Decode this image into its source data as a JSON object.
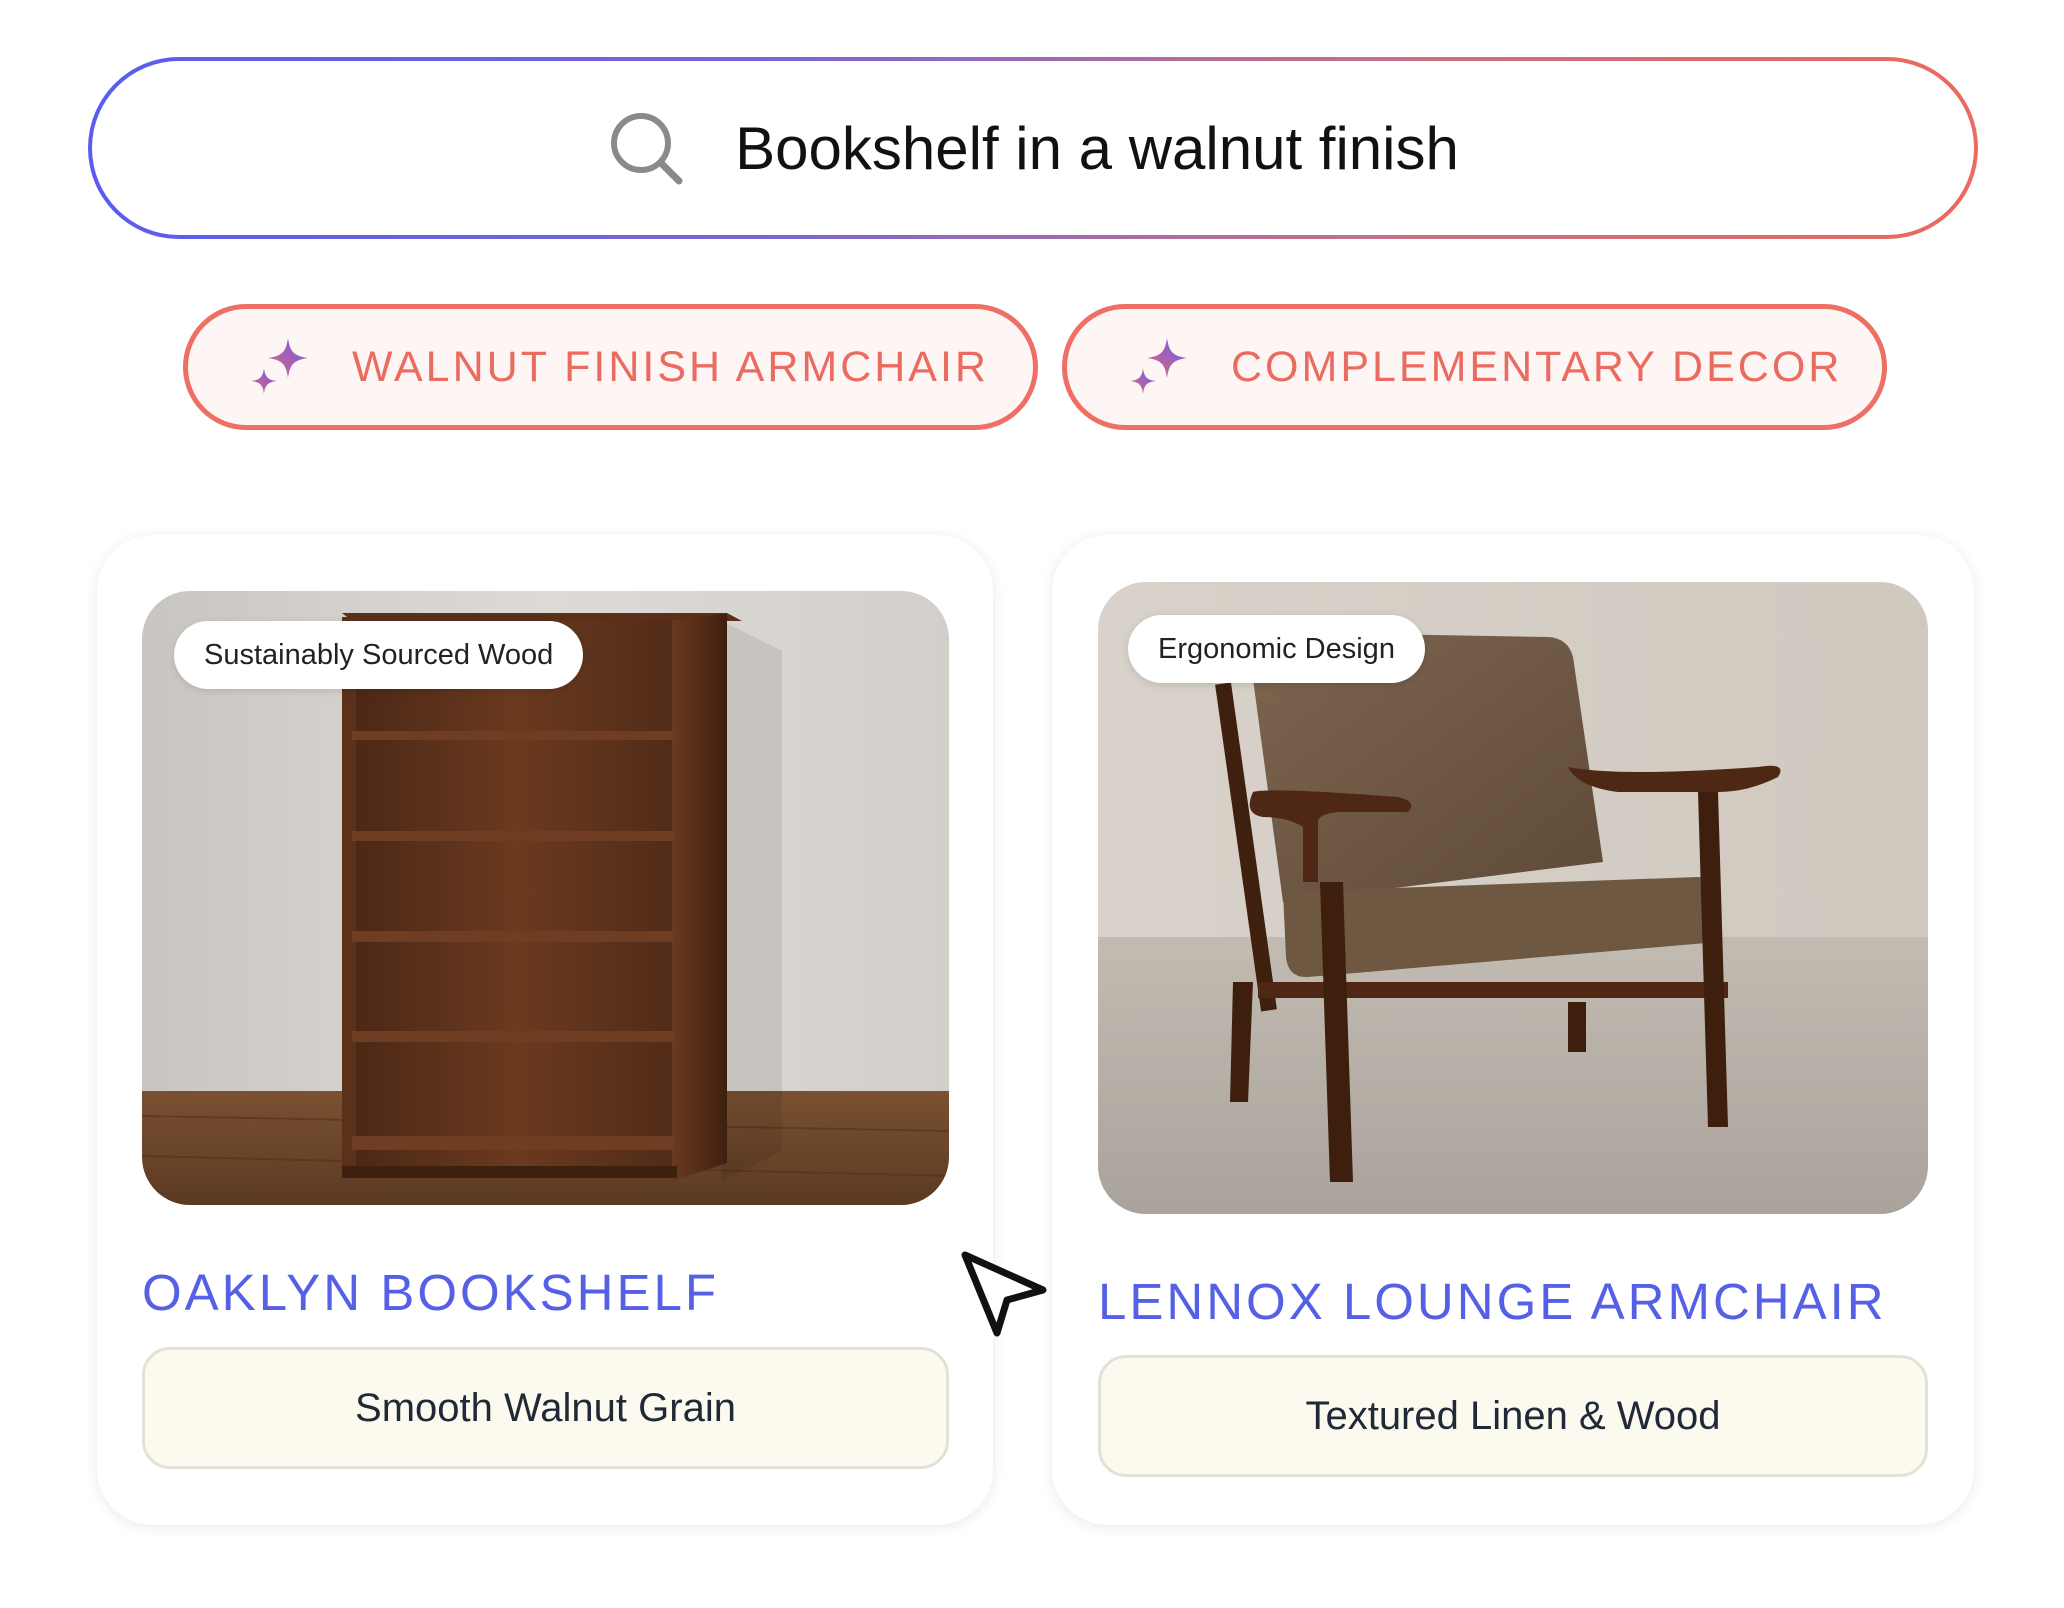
{
  "search": {
    "query": "Bookshelf in a walnut finish",
    "icon": "search-icon"
  },
  "suggestions": [
    {
      "label": "WALNUT FINISH ARMCHAIR",
      "icon": "sparkle-icon"
    },
    {
      "label": "COMPLEMENTARY DECOR",
      "icon": "sparkle-icon"
    }
  ],
  "products": [
    {
      "badge": "Sustainably Sourced Wood",
      "title": "OAKLYN BOOKSHELF",
      "feature": "Smooth Walnut Grain",
      "image": "walnut-bookshelf"
    },
    {
      "badge": "Ergonomic Design",
      "title": "LENNOX LOUNGE ARMCHAIR",
      "feature": "Textured Linen & Wood",
      "image": "lounge-armchair"
    }
  ],
  "colors": {
    "accent_blue": "#5560e6",
    "accent_coral": "#ea6b5f",
    "feature_bg": "#fcfaef"
  }
}
